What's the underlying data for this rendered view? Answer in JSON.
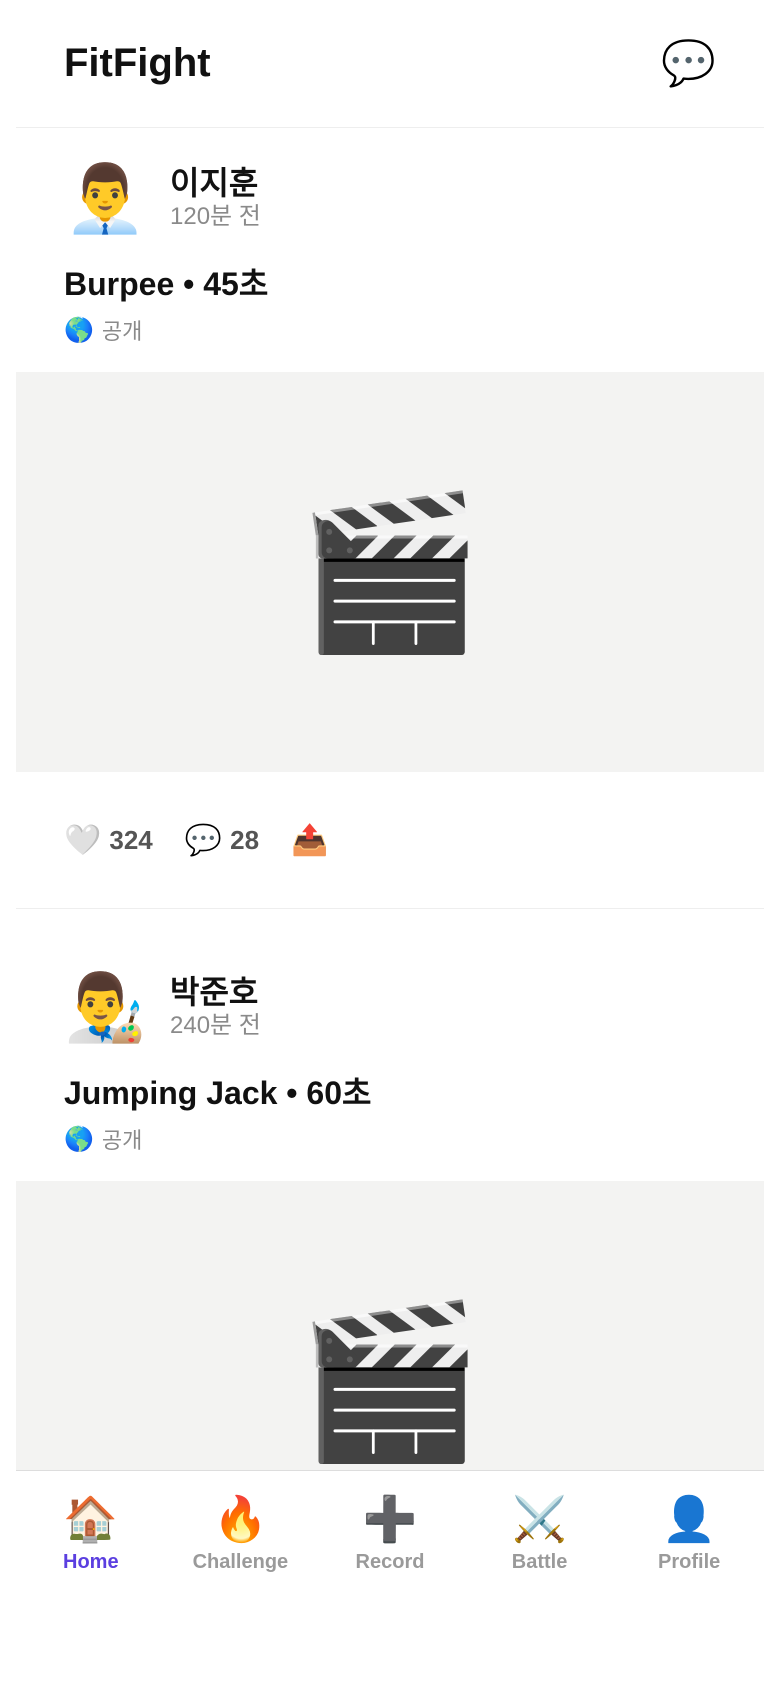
{
  "app": {
    "title": "FitFight",
    "messages_icon": "💬"
  },
  "posts": [
    {
      "avatar": "👨‍💼",
      "username": "이지훈",
      "time": "120분 전",
      "title": "Burpee • 45초",
      "visibility_icon": "🌎",
      "visibility": "공개",
      "media_icon": "🎬",
      "likes_icon": "🤍",
      "likes": "324",
      "comments_icon": "💬",
      "comments": "28",
      "share_icon": "📤"
    },
    {
      "avatar": "👨‍🎨",
      "username": "박준호",
      "time": "240분 전",
      "title": "Jumping Jack • 60초",
      "visibility_icon": "🌎",
      "visibility": "공개",
      "media_icon": "🎬"
    }
  ],
  "tabs": [
    {
      "icon": "🏠",
      "label": "Home",
      "active": true
    },
    {
      "icon": "🔥",
      "label": "Challenge",
      "active": false
    },
    {
      "icon": "➕",
      "label": "Record",
      "active": false
    },
    {
      "icon": "⚔️",
      "label": "Battle",
      "active": false
    },
    {
      "icon": "👤",
      "label": "Profile",
      "active": false
    }
  ],
  "colors": {
    "active_tab": "#5b3fe0",
    "inactive_tab": "#9a9a9a",
    "media_bg": "#f3f3f2"
  }
}
